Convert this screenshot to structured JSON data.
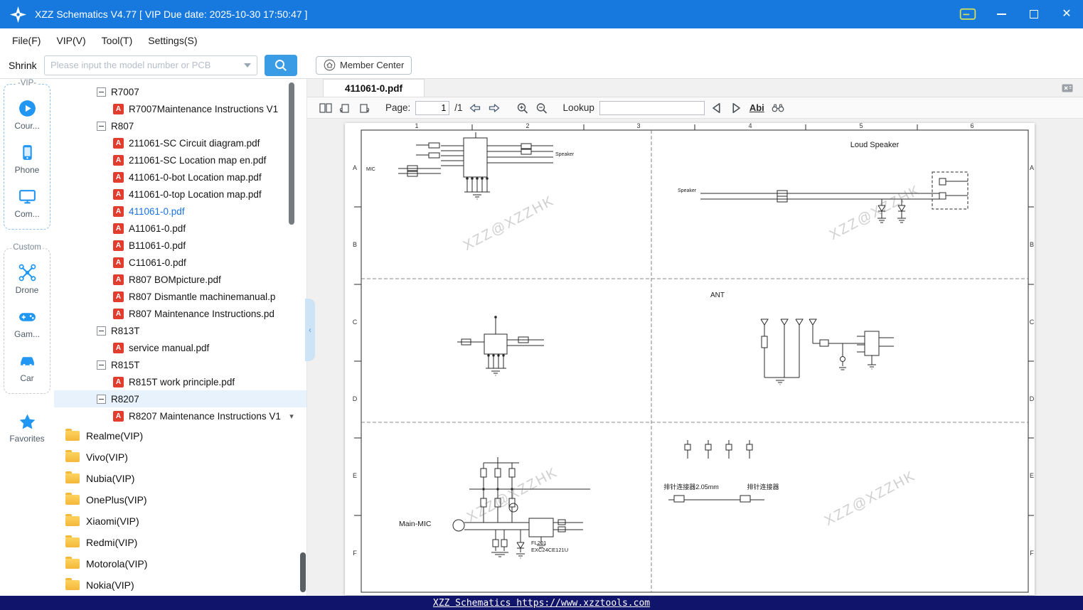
{
  "window": {
    "title": "XZZ Schematics V4.77 [ VIP Due date: 2025-10-30 17:50:47 ]"
  },
  "menubar": {
    "items": [
      {
        "label": "File(F)"
      },
      {
        "label": "VIP(V)"
      },
      {
        "label": "Tool(T)"
      },
      {
        "label": "Settings(S)"
      }
    ]
  },
  "toolbar": {
    "shrink": "Shrink",
    "search_placeholder": "Please input the model number or PCB",
    "member_center": "Member Center"
  },
  "sidebar": {
    "vip_group": "-VIP-",
    "items_vip": [
      {
        "label": "Cour...",
        "icon": "play-circle-icon"
      },
      {
        "label": "Phone",
        "icon": "phone-icon"
      },
      {
        "label": "Com...",
        "icon": "computer-icon"
      }
    ],
    "custom_group": "Custom",
    "items_custom": [
      {
        "label": "Drone",
        "icon": "drone-icon"
      },
      {
        "label": "Gam...",
        "icon": "gamepad-icon"
      },
      {
        "label": "Car",
        "icon": "car-icon"
      }
    ],
    "favorites": "Favorites"
  },
  "tree": {
    "items": [
      {
        "type": "group",
        "label": "R7007"
      },
      {
        "type": "pdf",
        "label": "R7007Maintenance Instructions V1"
      },
      {
        "type": "group",
        "label": "R807"
      },
      {
        "type": "pdf",
        "label": "211061-SC Circuit diagram.pdf"
      },
      {
        "type": "pdf",
        "label": "211061-SC Location map en.pdf"
      },
      {
        "type": "pdf",
        "label": "411061-0-bot Location map.pdf"
      },
      {
        "type": "pdf",
        "label": "411061-0-top Location map.pdf"
      },
      {
        "type": "pdf",
        "label": "411061-0.pdf",
        "selected": true
      },
      {
        "type": "pdf",
        "label": "A11061-0.pdf"
      },
      {
        "type": "pdf",
        "label": "B11061-0.pdf"
      },
      {
        "type": "pdf",
        "label": "C11061-0.pdf"
      },
      {
        "type": "pdf",
        "label": "R807 BOMpicture.pdf"
      },
      {
        "type": "pdf",
        "label": "R807 Dismantle machinemanual.p"
      },
      {
        "type": "pdf",
        "label": "R807 Maintenance Instructions.pd"
      },
      {
        "type": "group",
        "label": "R813T"
      },
      {
        "type": "pdf",
        "label": "service manual.pdf"
      },
      {
        "type": "group",
        "label": "R815T"
      },
      {
        "type": "pdf",
        "label": "R815T work principle.pdf"
      },
      {
        "type": "group",
        "label": "R8207"
      },
      {
        "type": "pdf",
        "label": "R8207 Maintenance Instructions V1"
      }
    ],
    "folders": [
      {
        "label": "Realme(VIP)"
      },
      {
        "label": "Vivo(VIP)"
      },
      {
        "label": "Nubia(VIP)"
      },
      {
        "label": "OnePlus(VIP)"
      },
      {
        "label": "Xiaomi(VIP)"
      },
      {
        "label": "Redmi(VIP)"
      },
      {
        "label": "Motorola(VIP)"
      },
      {
        "label": "Nokia(VIP)"
      }
    ]
  },
  "viewer": {
    "tab": "411061-0.pdf",
    "page_label": "Page:",
    "page_value": "1",
    "page_total": "/1",
    "lookup_label": "Lookup",
    "lookup_value": "",
    "abi_label": "Abi"
  },
  "schematic": {
    "columns": [
      "1",
      "2",
      "3",
      "4",
      "5",
      "6"
    ],
    "rows": [
      "A",
      "B",
      "C",
      "D",
      "E",
      "F"
    ],
    "labels": {
      "loud_speaker": "Loud Speaker",
      "ant": "ANT",
      "main_mic": "Main-MIC",
      "fl201": "FL201",
      "fl201_part": "EXC24CE121U",
      "speaker": "Speaker",
      "mic": "MIC",
      "connector_left": "排针连接器2.05mm",
      "connector_right": "排针连接器"
    },
    "watermark": "XZZ@XZZHK"
  },
  "statusbar": {
    "text": "XZZ Schematics https://www.xzztools.com"
  }
}
